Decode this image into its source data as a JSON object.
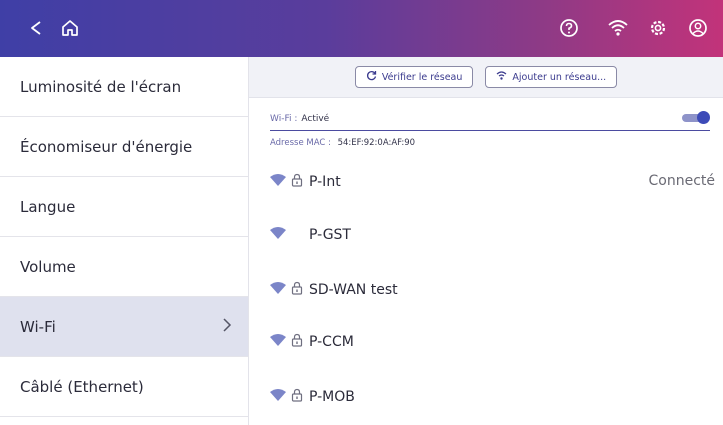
{
  "header": {
    "icons": [
      "back-icon",
      "home-icon",
      "help-icon",
      "wifi-status-icon",
      "settings-icon",
      "account-icon"
    ]
  },
  "sidebar": {
    "items": [
      {
        "label": "Luminosité de l'écran"
      },
      {
        "label": "Économiseur d'énergie"
      },
      {
        "label": "Langue"
      },
      {
        "label": "Volume"
      },
      {
        "label": "Wi-Fi",
        "selected": true
      },
      {
        "label": "Câblé (Ethernet)"
      }
    ]
  },
  "actions": {
    "check_network": "Vérifier le réseau",
    "add_network": "Ajouter un réseau..."
  },
  "wifi": {
    "label": "Wi-Fi :",
    "state": "Activé",
    "enabled": true,
    "mac_label": "Adresse MAC :",
    "mac_value": "54:EF:92:0A:AF:90"
  },
  "networks": [
    {
      "name": "P-Int",
      "secured": true,
      "status": "Connecté"
    },
    {
      "name": "P-GST",
      "secured": false,
      "status": ""
    },
    {
      "name": "SD-WAN test",
      "secured": true,
      "status": ""
    },
    {
      "name": "P-CCM",
      "secured": true,
      "status": ""
    },
    {
      "name": "P-MOB",
      "secured": true,
      "status": ""
    }
  ],
  "colors": {
    "accent": "#3d4bb8",
    "header_start": "#3f3fa6",
    "header_end": "#c2337a",
    "wifi_icon": "#7b85c8"
  }
}
